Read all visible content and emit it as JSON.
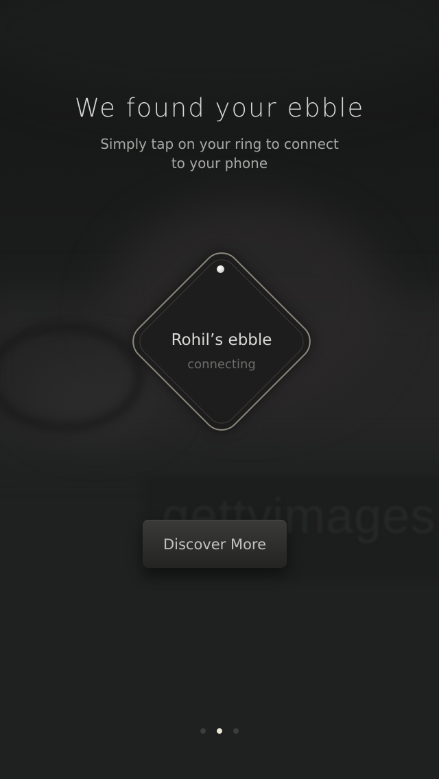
{
  "header": {
    "title": "We found your ebble",
    "subtitle_line1": "Simply tap on your ring to connect",
    "subtitle_line2": "to your phone"
  },
  "device_card": {
    "name": "Rohil’s ebble",
    "status": "connecting"
  },
  "actions": {
    "discover_label": "Discover More"
  },
  "background": {
    "watermark_text": "gettyimages"
  },
  "pager": {
    "count": 3,
    "active_index": 1
  },
  "colors": {
    "background": "#1f2020",
    "diamond_border": "#8e8a7e",
    "active_dot": "#e9e6d8",
    "inactive_dot": "#3b3c3c"
  }
}
